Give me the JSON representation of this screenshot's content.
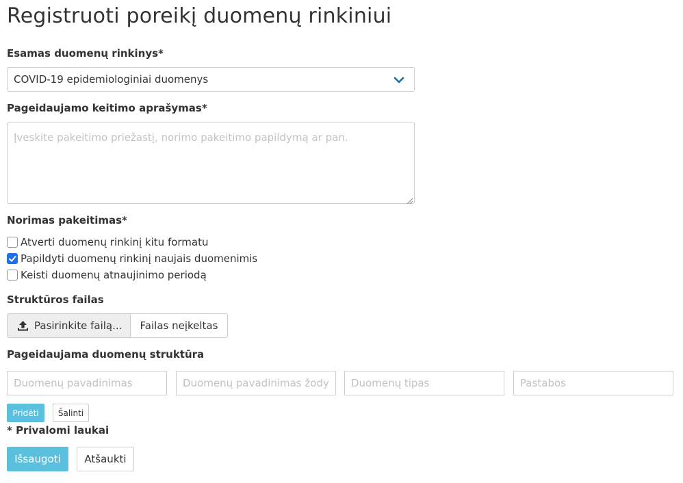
{
  "page": {
    "title": "Registruoti poreikį duomenų rinkiniui"
  },
  "dataset": {
    "label": "Esamas duomenų rinkinys*",
    "selected": "COVID-19 epidemiologiniai duomenys",
    "chevron_icon": "chevron-down-icon",
    "accent_color": "#1a6e99"
  },
  "description": {
    "label": "Pageidaujamo keitimo aprašymas*",
    "value": "",
    "placeholder": "Įveskite pakeitimo priežastį, norimo pakeitimo papildymą ar pan."
  },
  "change": {
    "label": "Norimas pakeitimas*",
    "options": [
      {
        "label": "Atverti duomenų rinkinį kitu formatu",
        "checked": false
      },
      {
        "label": "Papildyti duomenų rinkinį naujais duomenimis",
        "checked": true
      },
      {
        "label": "Keisti duomenų atnaujinimo periodą",
        "checked": false
      }
    ]
  },
  "file": {
    "label": "Struktūros failas",
    "choose_label": "Pasirinkite failą...",
    "status": "Failas neįkeltas",
    "upload_icon": "upload-icon"
  },
  "structure": {
    "label": "Pageidaujama duomenų struktūra",
    "fields": [
      {
        "placeholder": "Duomenų pavadinimas",
        "value": ""
      },
      {
        "placeholder": "Duomenų pavadinimas žodyne",
        "value": ""
      },
      {
        "placeholder": "Duomenų tipas",
        "value": ""
      },
      {
        "placeholder": "Pastabos",
        "value": ""
      }
    ],
    "add_label": "Pridėti",
    "remove_label": "Šalinti"
  },
  "required_note": "* Privalomi laukai",
  "actions": {
    "save_label": "Išsaugoti",
    "cancel_label": "Atšaukti"
  },
  "colors": {
    "primary": "#5bc0de",
    "checkbox": "#1a73e8"
  }
}
